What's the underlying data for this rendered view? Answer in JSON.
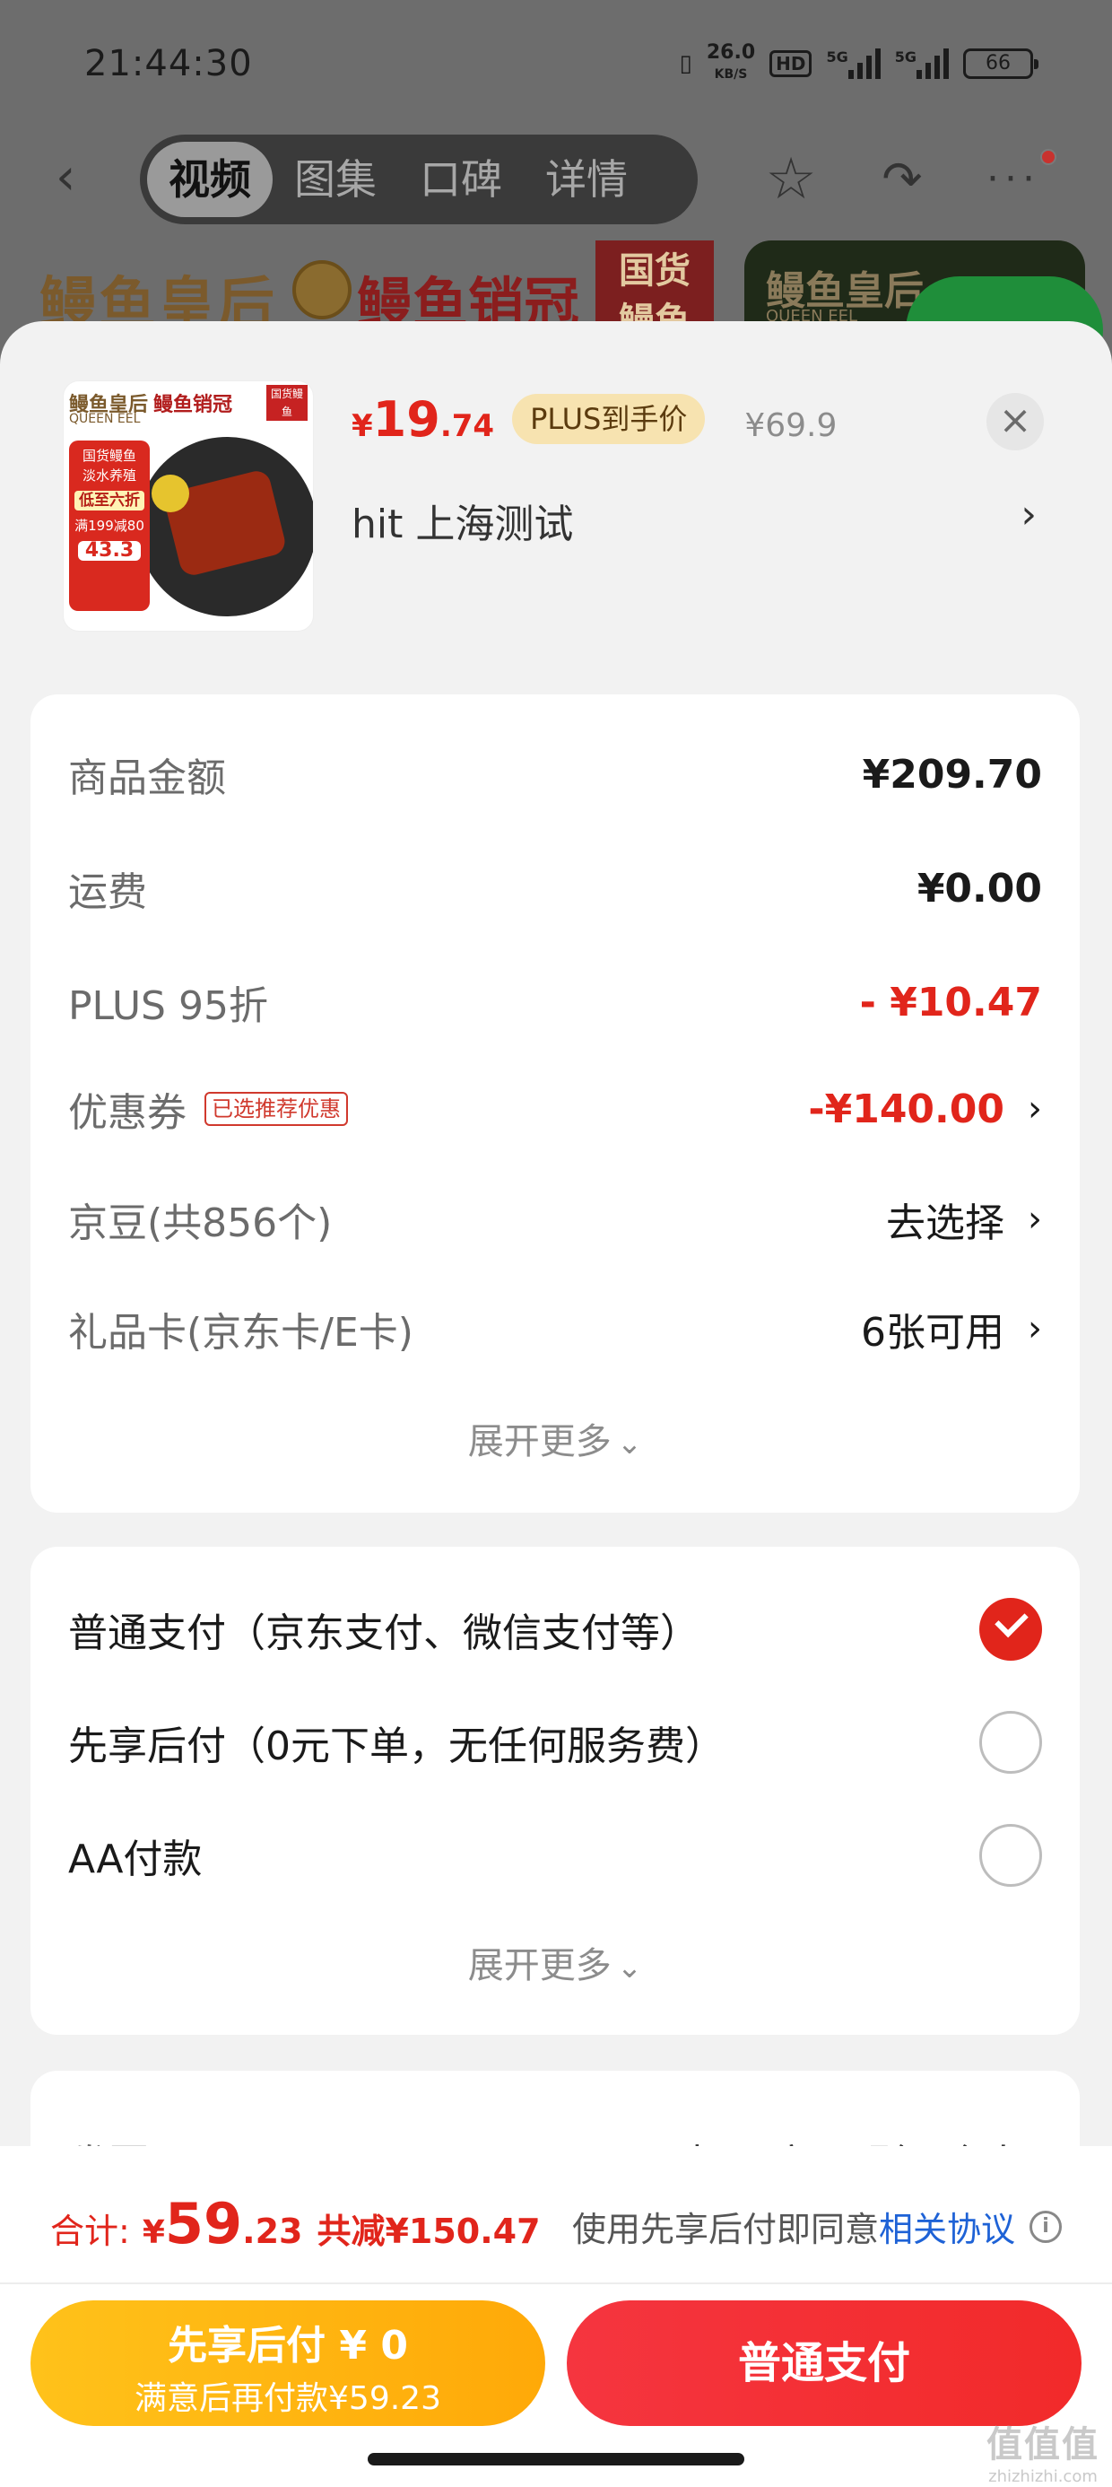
{
  "status_bar": {
    "time": "21:44:30",
    "net_speed_value": "26.0",
    "net_speed_unit": "KB/S",
    "hd_label": "HD",
    "signal1_label": "5G",
    "signal2_label": "5G",
    "battery": "66"
  },
  "top_nav": {
    "tabs": [
      {
        "label": "视频",
        "active": true
      },
      {
        "label": "图集",
        "active": false
      },
      {
        "label": "口碑",
        "active": false
      },
      {
        "label": "详情",
        "active": false
      }
    ],
    "icons": [
      "back-icon",
      "star-icon",
      "share-icon",
      "more-icon"
    ]
  },
  "banner": {
    "brand_name": "鳗鱼皇后",
    "award_text": "鳗鱼销冠",
    "badge_text": "国货鳗鱼",
    "brand_name_en": "QUEEN EEL"
  },
  "product": {
    "thumbnail": {
      "brand": "鳗鱼皇后",
      "brand_en": "QUEEN EEL",
      "award": "鳗鱼销冠",
      "badge": "国货鳗鱼",
      "tag_lines": [
        "国货鳗鱼",
        "淡水养殖"
      ],
      "tag_highlight": "低至六折",
      "tag_sub": "满199减80",
      "tag_price": "43.3"
    },
    "price_currency": "¥",
    "price_integer": "19",
    "price_decimal": ".74",
    "price_tag": "PLUS到手价",
    "original_price": "¥69.9",
    "spec": "hit  上海测试"
  },
  "summary": {
    "rows": [
      {
        "label": "商品金额",
        "value": "¥209.70",
        "style": "bold"
      },
      {
        "label": "运费",
        "value": "¥0.00",
        "style": "bold"
      },
      {
        "label": "PLUS 95折",
        "value": "- ¥10.47",
        "style": "red"
      },
      {
        "label": "优惠券",
        "badge": "已选推荐优惠",
        "value": "-¥140.00",
        "style": "red",
        "chevron": true
      },
      {
        "label": "京豆(共856个)",
        "value": "去选择",
        "style": "plain",
        "chevron": true
      },
      {
        "label": "礼品卡(京东卡/E卡)",
        "value": "6张可用",
        "style": "plain",
        "chevron": true
      }
    ],
    "expand_label": "展开更多"
  },
  "payment": {
    "options": [
      {
        "label": "普通支付（京东支付、微信支付等）",
        "selected": true
      },
      {
        "label": "先享后付（0元下单，无任何服务费）",
        "selected": false
      },
      {
        "label": "AA付款",
        "selected": false
      }
    ],
    "expand_label": "展开更多"
  },
  "invoice": {
    "label": "发票",
    "value": "电子(商品明细-个人)"
  },
  "footer": {
    "total_label": "合计:",
    "total_currency": "¥",
    "total_integer": "59",
    "total_decimal": ".23",
    "discount_text": "共减¥150.47",
    "agree_text": "使用先享后付即同意",
    "agree_link": "相关协议",
    "btn_later_title": "先享后付 ¥ 0",
    "btn_later_sub": "满意后再付款¥59.23",
    "btn_normal": "普通支付"
  },
  "watermark": {
    "text": "值值值",
    "site": "zhizhizhi.com"
  },
  "colors": {
    "accent_red": "#e1251b",
    "link_blue": "#1e62d6",
    "gold": "#ffa908"
  }
}
